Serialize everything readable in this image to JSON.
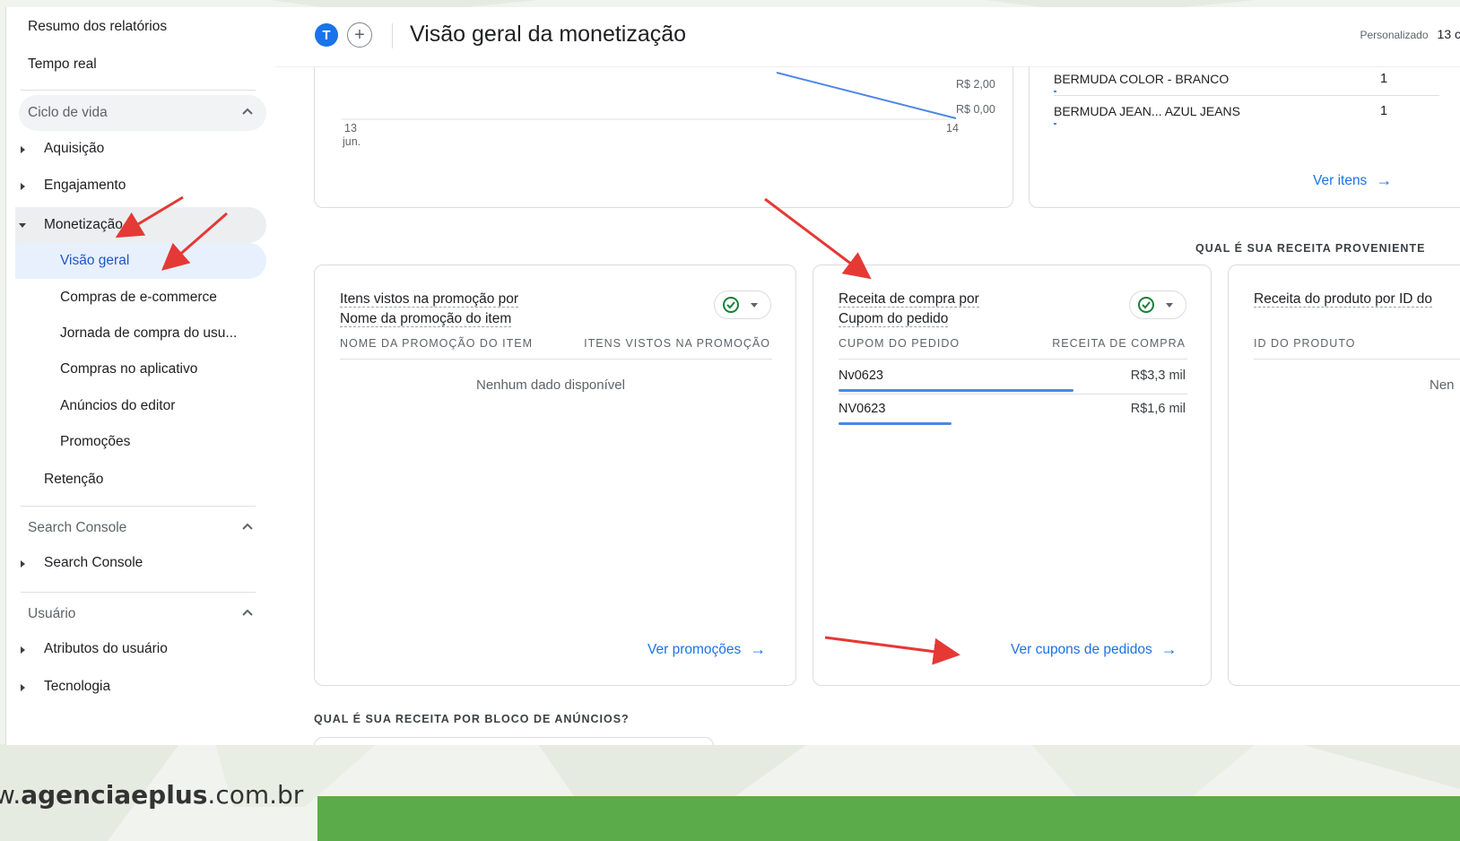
{
  "sidebar": {
    "top_items": [
      "Resumo dos relatórios",
      "Tempo real"
    ],
    "lifecycle": {
      "title": "Ciclo de vida",
      "aquisicao": "Aquisição",
      "engajamento": "Engajamento",
      "monetizacao": "Monetização",
      "monetizacao_children": [
        "Visão geral",
        "Compras de e-commerce",
        "Jornada de compra do usu...",
        "Compras no aplicativo",
        "Anúncios do editor",
        "Promoções"
      ],
      "retencao": "Retenção"
    },
    "search_console": {
      "title": "Search Console",
      "item": "Search Console"
    },
    "usuario": {
      "title": "Usuário",
      "items": [
        "Atributos do usuário",
        "Tecnologia"
      ]
    }
  },
  "header": {
    "avatar_letter": "T",
    "add_symbol": "+",
    "title": "Visão geral da monetização",
    "date_mode": "Personalizado",
    "date_value": "13 c"
  },
  "chart_top": {
    "y_ticks": [
      "R$ 2,00",
      "R$ 0,00"
    ],
    "x_ticks": [
      {
        "day": "13",
        "month": "jun."
      },
      {
        "day": "14",
        "month": ""
      }
    ]
  },
  "items_card": {
    "rows": [
      {
        "name": "BERMUDA COLOR - BRANCO",
        "value": "1"
      },
      {
        "name": "BERMUDA JEAN... AZUL JEANS",
        "value": "1"
      }
    ],
    "link": "Ver itens"
  },
  "section_right": "QUAL É SUA RECEITA PROVENIENTE",
  "promo_card": {
    "title_line1": "Itens vistos na promoção por",
    "title_line2": "Nome da promoção do item",
    "col1": "NOME DA PROMOÇÃO DO ITEM",
    "col2": "ITENS VISTOS NA PROMOÇÃO",
    "empty": "Nenhum dado disponível",
    "link": "Ver promoções"
  },
  "coupon_card": {
    "title_line1": "Receita de compra por",
    "title_line2": "Cupom do pedido",
    "col1": "CUPOM DO PEDIDO",
    "col2": "RECEITA DE COMPRA",
    "rows": [
      {
        "code": "Nv0623",
        "value": "R$3,3 mil",
        "share": 1.0
      },
      {
        "code": "NV0623",
        "value": "R$1,6 mil",
        "share": 0.48
      }
    ],
    "link": "Ver cupons de pedidos"
  },
  "product_card": {
    "title": "Receita do produto por ID do",
    "col1": "ID DO PRODUTO",
    "empty_partial": "Nen"
  },
  "section_bottom": "QUAL É SUA RECEITA POR BLOCO DE ANÚNCIOS?",
  "footer": {
    "prefix": "w.",
    "brand": "agenciaeplus",
    "suffix": ".com.br"
  },
  "colors": {
    "accent": "#1a73e8",
    "arrow": "#e53935",
    "footer_green": "#5cab4a"
  },
  "icons": [
    "check-circle-icon",
    "chevron-up-icon",
    "arrow-right-icon",
    "add-icon"
  ]
}
